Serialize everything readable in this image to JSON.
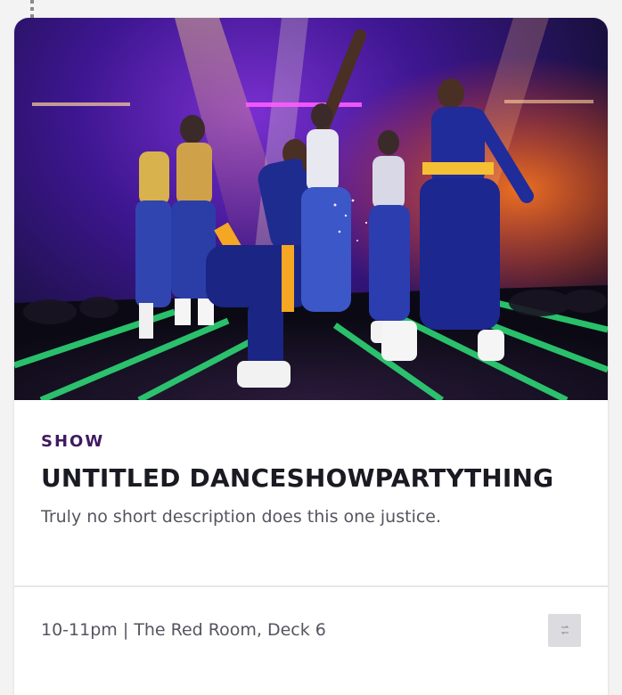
{
  "event": {
    "category": "SHOW",
    "title": "UNTITLED DANCESHOWPARTYTHING",
    "description": "Truly no short description does this one justice.",
    "schedule": "10-11pm | The Red Room, Deck 6"
  },
  "icons": {
    "action": "swap-icon"
  },
  "colors": {
    "category": "#3f1a62",
    "title": "#1a1a22",
    "text_muted": "#555560",
    "card_bg": "#ffffff",
    "page_bg": "#f3f3f4"
  }
}
